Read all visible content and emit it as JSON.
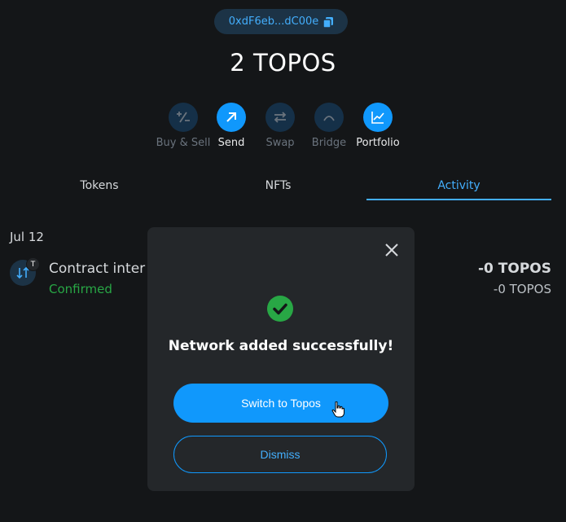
{
  "account": {
    "address_short": "0xdF6eb...dC00e",
    "copy_icon": "copy-icon"
  },
  "balance": {
    "amount": "2 TOPOS"
  },
  "actions": [
    {
      "label": "Buy & Sell",
      "icon": "plus-minus-icon",
      "state": "disabled"
    },
    {
      "label": "Send",
      "icon": "arrow-up-right-icon",
      "state": "enabled"
    },
    {
      "label": "Swap",
      "icon": "swap-arrows-icon",
      "state": "disabled"
    },
    {
      "label": "Bridge",
      "icon": "bridge-icon",
      "state": "disabled"
    },
    {
      "label": "Portfolio",
      "icon": "chart-icon",
      "state": "enabled"
    }
  ],
  "tabs": [
    {
      "label": "Tokens",
      "active": false
    },
    {
      "label": "NFTs",
      "active": false
    },
    {
      "label": "Activity",
      "active": true
    }
  ],
  "activity": {
    "date": "Jul 12",
    "items": [
      {
        "title": "Contract inter",
        "status": "Confirmed",
        "amount": "-0 TOPOS",
        "amount_secondary": "-0 TOPOS",
        "badge": "T",
        "icon": "contract-interaction-icon"
      }
    ]
  },
  "modal": {
    "title": "Network added successfully!",
    "primary_button": "Switch to Topos",
    "secondary_button": "Dismiss",
    "icon": "success-check-icon"
  },
  "colors": {
    "background": "#141618",
    "accent": "#1098fc",
    "accent_text": "#43aefc",
    "success": "#28a745",
    "modal_bg": "#24272a"
  }
}
